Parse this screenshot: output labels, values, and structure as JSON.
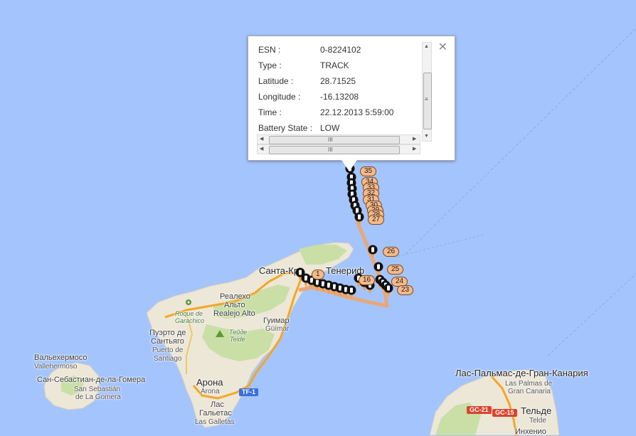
{
  "info_window": {
    "rows": [
      {
        "key": "ESN :",
        "value": "0-8224102"
      },
      {
        "key": "Type :",
        "value": "TRACK"
      },
      {
        "key": "Latitude :",
        "value": "28.71525"
      },
      {
        "key": "Longitude :",
        "value": "-16.13208"
      },
      {
        "key": "Time :",
        "value": "22.12.2013 5:59:00"
      },
      {
        "key": "Battery State :",
        "value": "LOW"
      }
    ],
    "close_glyph": "✕",
    "scroll_up": "▲",
    "scroll_down": "▼",
    "scroll_left": "◀",
    "scroll_right": "▶",
    "grip_v": "≡",
    "grip_h": "III"
  },
  "map": {
    "place_labels": [
      {
        "id": "santa-cruz",
        "text": "Санта-Кру"
      },
      {
        "id": "tenerife-partial",
        "text": "Тенериф"
      },
      {
        "id": "realejo-ru1",
        "text": "Реалехо"
      },
      {
        "id": "realejo-ru2",
        "text": "Альто"
      },
      {
        "id": "realejo-es",
        "text": "Realejo Alto"
      },
      {
        "id": "roque1",
        "text": "Roque de"
      },
      {
        "id": "roque2",
        "text": "Garachico"
      },
      {
        "id": "puerto-ru1",
        "text": "Пуэрто де"
      },
      {
        "id": "puerto-ru2",
        "text": "Сантьяго"
      },
      {
        "id": "puerto-es1",
        "text": "Puerto de"
      },
      {
        "id": "puerto-es2",
        "text": "Santiago"
      },
      {
        "id": "teide-ru",
        "text": "Тейде"
      },
      {
        "id": "teide-es",
        "text": "Teide"
      },
      {
        "id": "guimar-ru",
        "text": "Гуимар"
      },
      {
        "id": "guimar-es",
        "text": "Güímar"
      },
      {
        "id": "arona-ru",
        "text": "Арона"
      },
      {
        "id": "arona-es",
        "text": "Arona"
      },
      {
        "id": "las-ru",
        "text": "Лас"
      },
      {
        "id": "galletas-ru",
        "text": "Гальетас"
      },
      {
        "id": "galletas-es",
        "text": "Las Galletas"
      },
      {
        "id": "vallehermoso-ru",
        "text": "Вальехермосо"
      },
      {
        "id": "vallehermoso-es",
        "text": "Vallehermoso"
      },
      {
        "id": "gomera-ru",
        "text": "Сан-Себастиан-де-ла-Гомера"
      },
      {
        "id": "gomera-es1",
        "text": "San Sebastián"
      },
      {
        "id": "gomera-es2",
        "text": "de La Gomera"
      },
      {
        "id": "laspalmas-ru",
        "text": "Лас-Пальмас-де-Гран-Канария"
      },
      {
        "id": "laspalmas-es1",
        "text": "Las Palmas de"
      },
      {
        "id": "laspalmas-es2",
        "text": "Gran Canaria"
      },
      {
        "id": "telde-ru",
        "text": "Тельде"
      },
      {
        "id": "telde-es",
        "text": "Telde"
      },
      {
        "id": "ingenio-ru",
        "text": "Инхенио"
      }
    ],
    "road_shields": [
      {
        "id": "tf1",
        "text": "TF-1",
        "color": "blue"
      },
      {
        "id": "gc21",
        "text": "GC-21",
        "color": "red"
      },
      {
        "id": "gc15",
        "text": "GC-15",
        "color": "red"
      }
    ],
    "colors": {
      "sea": "#a4c4fd",
      "land": "#ede7d8",
      "forest": "#c9dfa6",
      "highway": "#f5a623",
      "track": "#e8a878",
      "marker": "#111111",
      "marker_tip": "#f5a04a",
      "label_fill": "#f5b98a"
    },
    "track_labels": [
      {
        "n": "35"
      },
      {
        "n": "34"
      },
      {
        "n": "33"
      },
      {
        "n": "32"
      },
      {
        "n": "31"
      },
      {
        "n": "30"
      },
      {
        "n": "29"
      },
      {
        "n": "28"
      },
      {
        "n": "27"
      },
      {
        "n": "26"
      },
      {
        "n": "25"
      },
      {
        "n": "24"
      },
      {
        "n": "23"
      },
      {
        "n": "16"
      },
      {
        "n": "1"
      }
    ]
  }
}
